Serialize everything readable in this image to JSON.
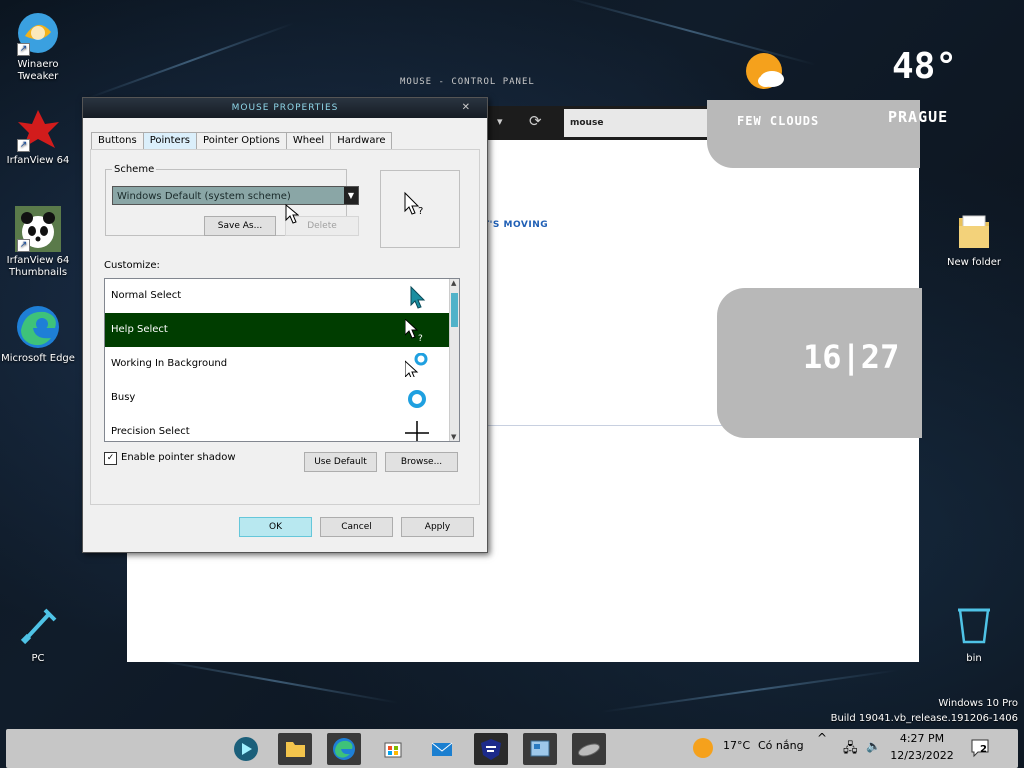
{
  "desktop": {
    "icons": [
      {
        "label": "Winaero\nTweaker"
      },
      {
        "label": "IrfanView 64"
      },
      {
        "label": "IrfanView 64\nThumbnails"
      },
      {
        "label": "Microsoft Edge"
      },
      {
        "label": "PC"
      },
      {
        "label": "New folder"
      },
      {
        "label": "bin"
      }
    ],
    "skin_title": "MOUSE - CONTROL PANEL",
    "weather": {
      "temp": "48°",
      "condition": "FEW CLOUDS",
      "city": "PRAGUE"
    },
    "clock_widget": "16|27",
    "moving_text": "T'S MOVING",
    "address_text": "mouse",
    "os_name": "Windows 10 Pro",
    "build": "Build 19041.vb_release.191206-1406"
  },
  "dialog": {
    "title": "MOUSE PROPERTIES",
    "tabs": [
      "Buttons",
      "Pointers",
      "Pointer Options",
      "Wheel",
      "Hardware"
    ],
    "active_tab": "Pointers",
    "scheme_label": "Scheme",
    "scheme_value": "Windows Default (system scheme)",
    "save_as": "Save As...",
    "delete": "Delete",
    "customize_label": "Customize:",
    "pointers": [
      {
        "name": "Normal Select"
      },
      {
        "name": "Help Select"
      },
      {
        "name": "Working In Background"
      },
      {
        "name": "Busy"
      },
      {
        "name": "Precision Select"
      }
    ],
    "shadow_label": "Enable pointer shadow",
    "use_default": "Use Default",
    "browse": "Browse...",
    "ok": "OK",
    "cancel": "Cancel",
    "apply": "Apply"
  },
  "taskbar": {
    "weather_temp": "17°C",
    "weather_text": "Có nắng",
    "time": "4:27 PM",
    "date": "12/23/2022",
    "notifications": "2"
  },
  "colors": {
    "selected_row": "#003d00",
    "accent": "#4fb2c9",
    "ok_button": "#b8e8f0"
  }
}
